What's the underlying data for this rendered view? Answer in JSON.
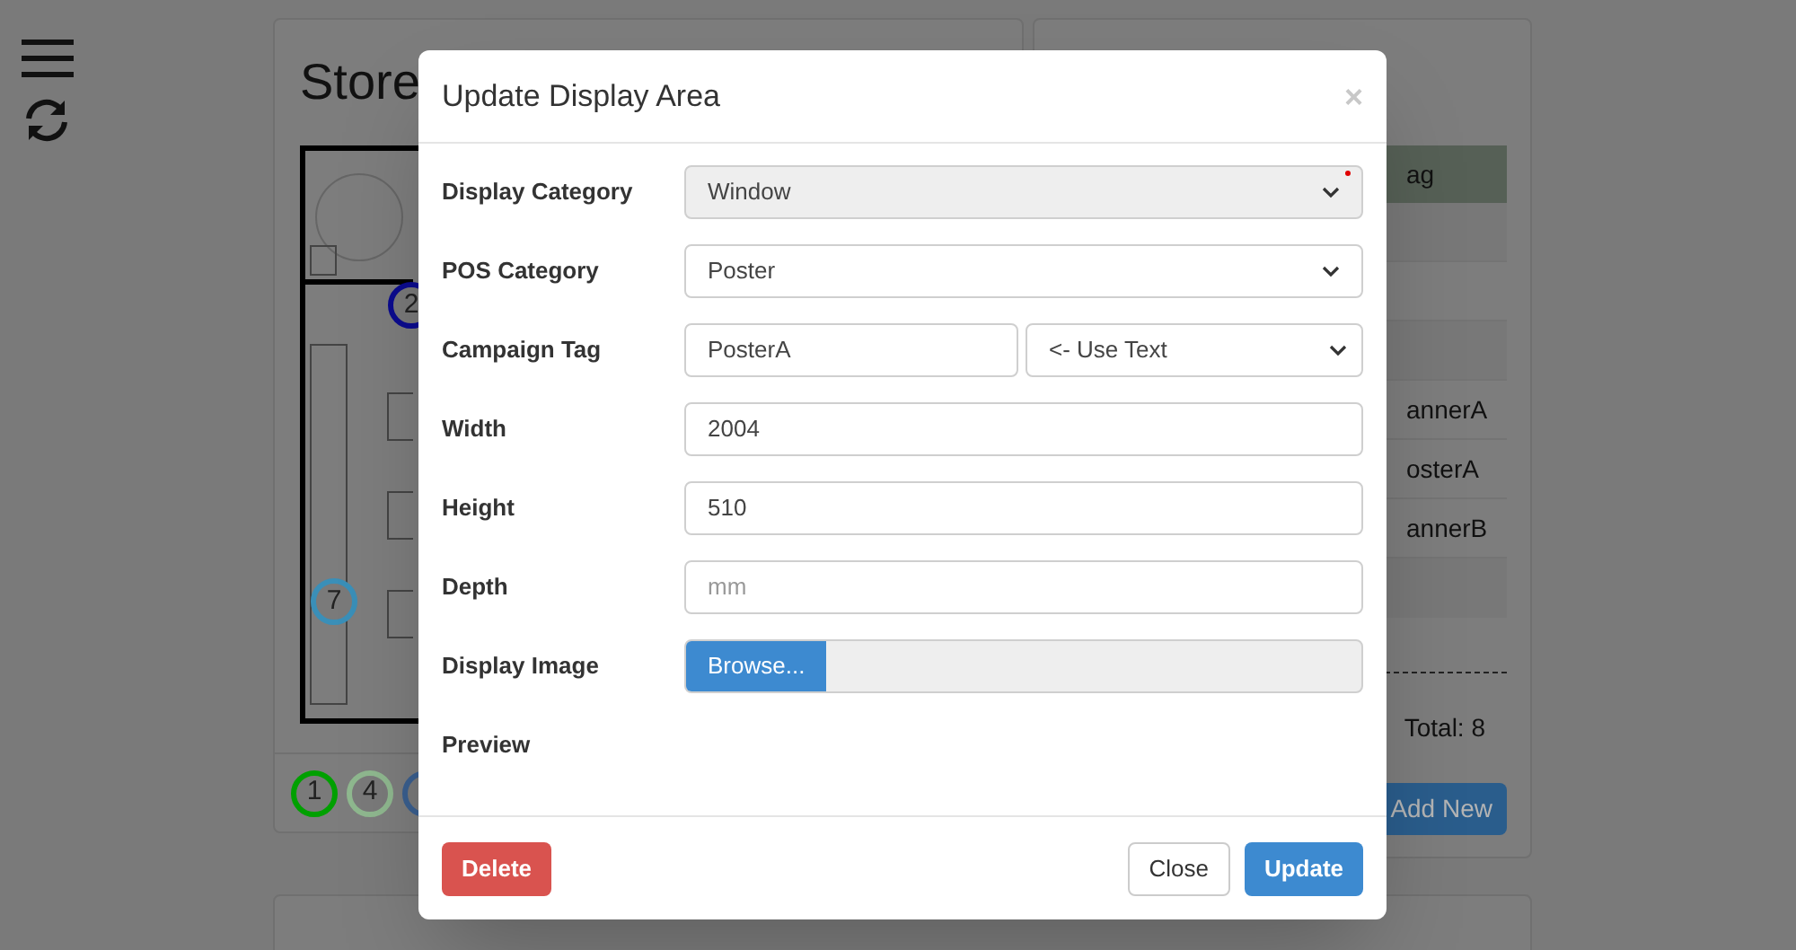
{
  "store_panel": {
    "title": "Store",
    "map_markers": [
      {
        "label": "2",
        "color": "#0b0b8f"
      },
      {
        "label": "7",
        "color": "#3a8fb8"
      }
    ],
    "legend_markers": [
      {
        "label": "1",
        "color": "#00a000"
      },
      {
        "label": "4",
        "color": "#8fb88f"
      }
    ]
  },
  "tags_panel": {
    "header": "ag",
    "rows": [
      {
        "tag": "annerA"
      },
      {
        "tag": "osterA"
      },
      {
        "tag": "annerB"
      }
    ],
    "total": "Total: 8",
    "add_button": "Add New"
  },
  "modal": {
    "title": "Update Display Area",
    "close": "×",
    "fields": [
      {
        "kind": "select",
        "label": "Display Category",
        "value": "Window",
        "disabled": true,
        "required": true
      },
      {
        "kind": "select",
        "label": "POS Category",
        "value": "Poster",
        "disabled": false,
        "required": false
      },
      {
        "kind": "text_with_select",
        "label": "Campaign Tag",
        "value": "PosterA",
        "select_value": "<- Use Text"
      },
      {
        "kind": "input",
        "label": "Width",
        "value": "2004"
      },
      {
        "kind": "input",
        "label": "Height",
        "value": "510"
      },
      {
        "kind": "input",
        "label": "Depth",
        "placeholder": "mm"
      },
      {
        "kind": "file",
        "label": "Display Image",
        "button": "Browse..."
      },
      {
        "kind": "preview",
        "label": "Preview"
      }
    ],
    "buttons": {
      "delete": "Delete",
      "close": "Close",
      "update": "Update"
    }
  }
}
